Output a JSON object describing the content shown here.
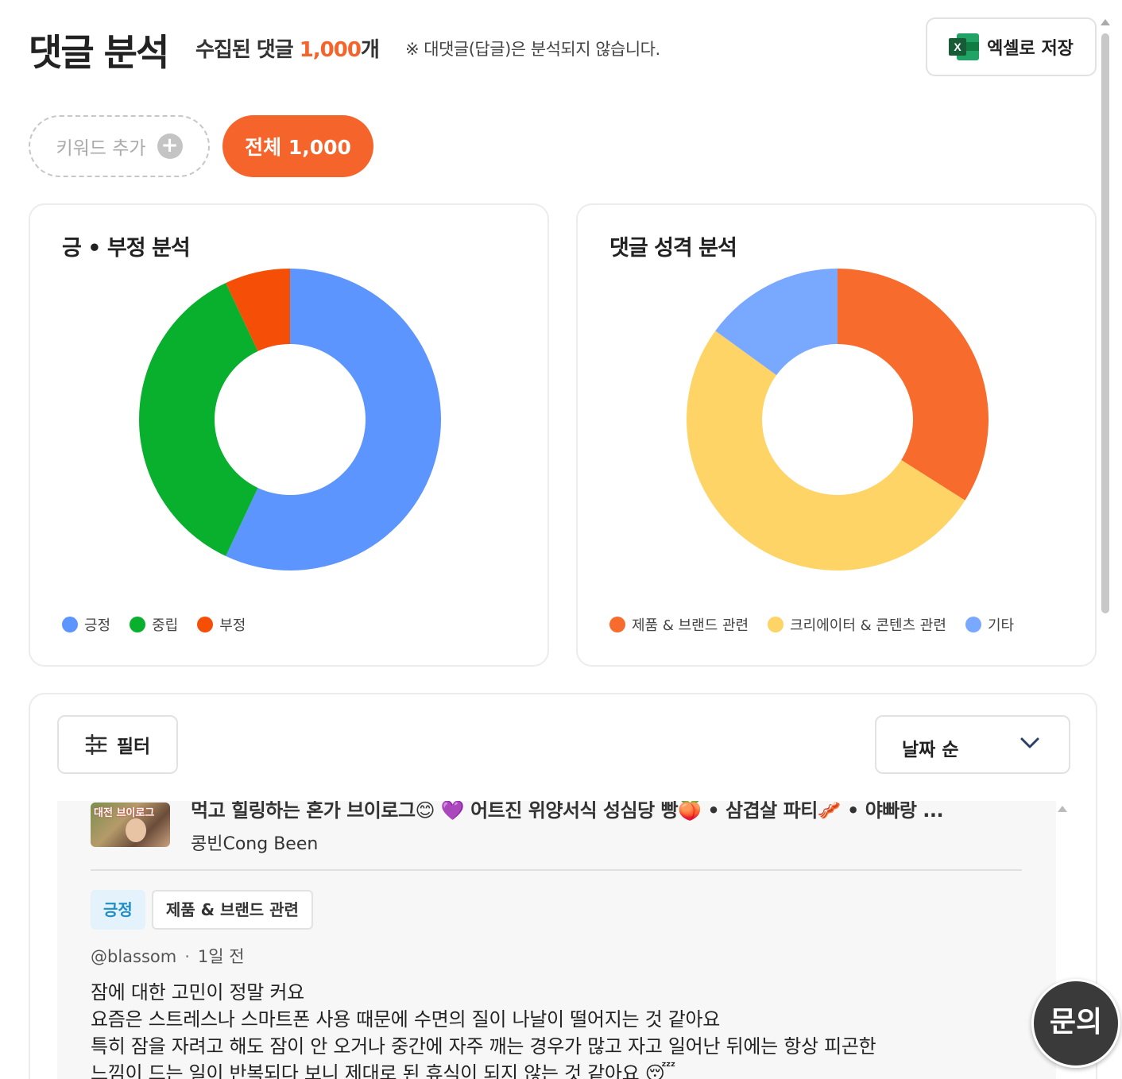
{
  "header": {
    "title": "댓글 분석",
    "collected_prefix": "수집된 댓글 ",
    "collected_count": "1,000",
    "collected_suffix": "개",
    "notice": "※ 대댓글(답글)은 분석되지 않습니다.",
    "excel_label": "엑셀로 저장"
  },
  "keywords": {
    "add_label": "키워드 추가",
    "all_label": "전체 1,000"
  },
  "sentiment_chart": {
    "title": "긍 • 부정 분석",
    "legend": [
      {
        "label": "긍정",
        "color": "#5b95fd"
      },
      {
        "label": "중립",
        "color": "#08b02d"
      },
      {
        "label": "부정",
        "color": "#f54f07"
      }
    ]
  },
  "type_chart": {
    "title": "댓글 성격 분석",
    "legend": [
      {
        "label": "제품 & 브랜드 관련",
        "color": "#f76b2c"
      },
      {
        "label": "크리에이터 & 콘텐츠 관련",
        "color": "#ffd466"
      },
      {
        "label": "기타",
        "color": "#78a8ff"
      }
    ]
  },
  "chart_data": [
    {
      "type": "pie",
      "title": "긍 • 부정 분석",
      "categories": [
        "긍정",
        "중립",
        "부정"
      ],
      "values": [
        57,
        36,
        7
      ],
      "colors": [
        "#5b95fd",
        "#08b02d",
        "#f54f07"
      ],
      "legend": "bottom-left"
    },
    {
      "type": "pie",
      "title": "댓글 성격 분석",
      "categories": [
        "제품 & 브랜드 관련",
        "크리에이터 & 콘텐츠 관련",
        "기타"
      ],
      "values": [
        34,
        51,
        15
      ],
      "colors": [
        "#f76b2c",
        "#ffd466",
        "#78a8ff"
      ],
      "legend": "bottom-left"
    }
  ],
  "list": {
    "filter_label": "필터",
    "sort_label": "날짜 순",
    "video": {
      "title": "먹고 힐링하는 혼가 브이로그😊 💜 어트진 위양서식 성심당 빵🍑 • 삼겹살 파티🥓 • 야빠랑 ...",
      "thumb_text": "대전 브이로그",
      "channel": "콩빈Cong Been"
    },
    "comment": {
      "sentiment_tag": "긍정",
      "type_tag": "제품 & 브랜드 관련",
      "author": "@blassom",
      "time": "1일 전",
      "lines": [
        "잠에 대한 고민이 정말 커요",
        "요즘은 스트레스나 스마트폰 사용 때문에 수면의 질이 나날이 떨어지는 것 같아요",
        "특히 잠을 자려고 해도 잠이 안 오거나 중간에 자주 깨는 경우가 많고 자고 일어난 뒤에는 항상 피곤한",
        "느낌이 드는 일이 반복되다 보니 제대로 된 휴식이 되지 않는 것 같아요 😴"
      ]
    }
  },
  "inquiry_label": "문의"
}
